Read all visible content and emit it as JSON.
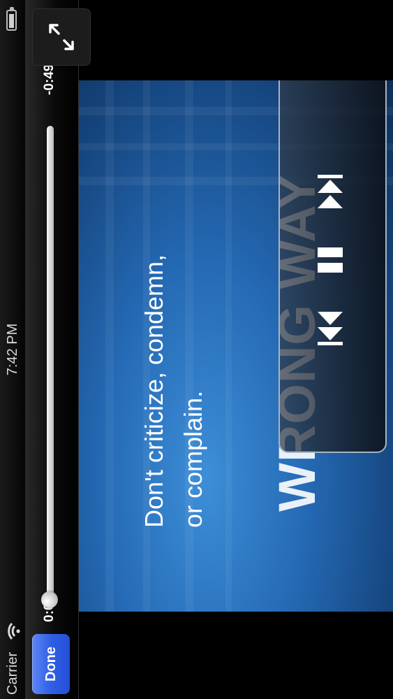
{
  "status_bar": {
    "carrier": "Carrier",
    "time": "7:42 PM",
    "icons": {
      "wifi": "wifi-icon",
      "battery": "battery-icon"
    }
  },
  "player": {
    "done_label": "Done",
    "elapsed_time": "0:00",
    "remaining_time": "-0:49",
    "progress": 0.0,
    "fullscreen_icon": "fullscreen-toggle-icon"
  },
  "video": {
    "caption_line1": "Don't criticize, condemn,",
    "caption_line2": "or complain.",
    "banner_text": "WRONG WAY"
  },
  "controls": {
    "previous_icon": "skip-back-icon",
    "pause_icon": "pause-icon",
    "next_icon": "skip-forward-icon"
  },
  "colors": {
    "done_button": "#2f5fe4",
    "progress_fill": "#2d68e6",
    "video_blue": "#2468b2"
  }
}
